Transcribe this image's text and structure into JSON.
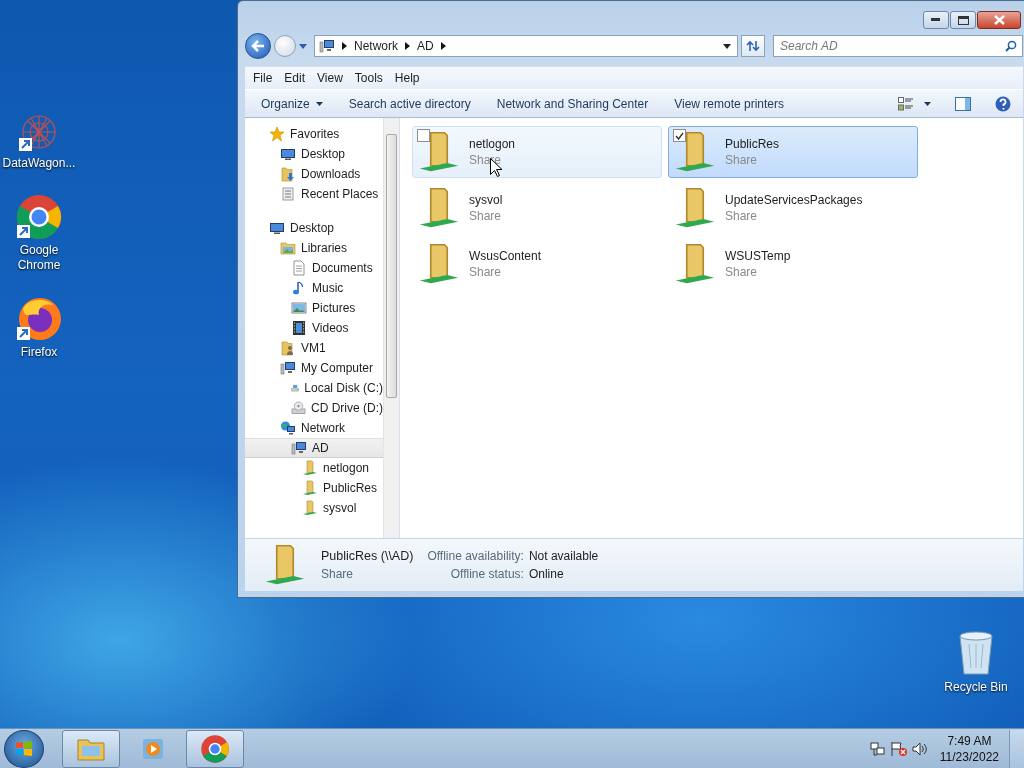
{
  "desktop_icons": [
    {
      "label": "DataWagon...",
      "kind": "datawagon"
    },
    {
      "label": "Google Chrome",
      "kind": "chrome"
    },
    {
      "label": "Firefox",
      "kind": "firefox"
    }
  ],
  "recycle_bin": {
    "label": "Recycle Bin"
  },
  "window": {
    "address": [
      "Network",
      "AD"
    ],
    "search": {
      "placeholder": "Search AD"
    },
    "menu": [
      "File",
      "Edit",
      "View",
      "Tools",
      "Help"
    ],
    "toolbar": [
      {
        "label": "Organize",
        "kind": "menu"
      },
      {
        "label": "Search active directory",
        "kind": "button"
      },
      {
        "label": "Network and Sharing Center",
        "kind": "button"
      },
      {
        "label": "View remote printers",
        "kind": "button"
      }
    ],
    "navigation": [
      {
        "label": "Favorites",
        "kind": "star",
        "selected": false,
        "children": [
          {
            "label": "Desktop",
            "kind": "monitor",
            "selected": false
          },
          {
            "label": "Downloads",
            "kind": "downloads",
            "selected": false
          },
          {
            "label": "Recent Places",
            "kind": "recent",
            "selected": false
          }
        ]
      },
      {
        "label": "Desktop",
        "kind": "monitor",
        "selected": false,
        "children": [
          {
            "label": "Libraries",
            "kind": "library",
            "selected": false,
            "children": [
              {
                "label": "Documents",
                "kind": "document",
                "selected": false
              },
              {
                "label": "Music",
                "kind": "music",
                "selected": false
              },
              {
                "label": "Pictures",
                "kind": "picture",
                "selected": false
              },
              {
                "label": "Videos",
                "kind": "video",
                "selected": false
              }
            ]
          },
          {
            "label": "VM1",
            "kind": "user",
            "selected": false
          },
          {
            "label": "My Computer",
            "kind": "computer",
            "selected": false,
            "children": [
              {
                "label": "Local Disk (C:)",
                "kind": "drive",
                "selected": false
              },
              {
                "label": "CD Drive (D:)",
                "kind": "cd",
                "selected": false
              }
            ]
          },
          {
            "label": "Network",
            "kind": "network",
            "selected": false,
            "children": [
              {
                "label": "AD",
                "kind": "computer",
                "selected": true,
                "children": [
                  {
                    "label": "netlogon",
                    "kind": "share",
                    "selected": false
                  },
                  {
                    "label": "PublicRes",
                    "kind": "share",
                    "selected": false
                  },
                  {
                    "label": "sysvol",
                    "kind": "share",
                    "selected": false
                  }
                ]
              }
            ]
          }
        ]
      }
    ],
    "items": [
      {
        "name": "netlogon",
        "type": "Share",
        "selected": false,
        "hovered": true
      },
      {
        "name": "PublicRes",
        "type": "Share",
        "selected": true,
        "hovered": false
      },
      {
        "name": "sysvol",
        "type": "Share",
        "selected": false,
        "hovered": false
      },
      {
        "name": "UpdateServicesPackages",
        "type": "Share",
        "selected": false,
        "hovered": false
      },
      {
        "name": "WsusContent",
        "type": "Share",
        "selected": false,
        "hovered": false
      },
      {
        "name": "WSUSTemp",
        "type": "Share",
        "selected": false,
        "hovered": false
      }
    ],
    "details": {
      "name": "PublicRes (\\\\AD)",
      "type": "Share",
      "fields": [
        {
          "label": "Offline availability:",
          "value": "Not available"
        },
        {
          "label": "Offline status:",
          "value": "Online"
        }
      ]
    }
  },
  "taskbar": {
    "apps": [
      {
        "kind": "explorer",
        "open": true
      },
      {
        "kind": "media",
        "open": false
      },
      {
        "kind": "chrome",
        "open": true
      }
    ],
    "time": "7:49 AM",
    "date": "11/23/2022"
  }
}
